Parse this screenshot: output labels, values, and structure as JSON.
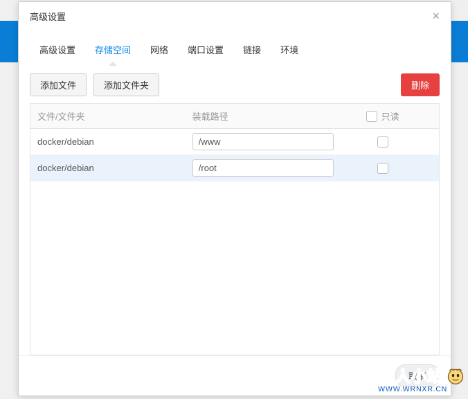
{
  "modal": {
    "title": "高级设置",
    "close": "×"
  },
  "tabs": {
    "items": [
      {
        "label": "高级设置"
      },
      {
        "label": "存储空间"
      },
      {
        "label": "网络"
      },
      {
        "label": "端口设置"
      },
      {
        "label": "链接"
      },
      {
        "label": "环境"
      }
    ]
  },
  "toolbar": {
    "add_file": "添加文件",
    "add_folder": "添加文件夹",
    "delete": "删除"
  },
  "table": {
    "headers": {
      "file": "文件/文件夹",
      "mount": "装载路径",
      "readonly": "只读"
    },
    "rows": [
      {
        "file": "docker/debian",
        "mount": "/www"
      },
      {
        "file": "docker/debian",
        "mount": "/root"
      }
    ]
  },
  "footer": {
    "cancel": "取消"
  },
  "watermark": {
    "text": "仙人小站",
    "url": "WWW.WRNXR.CN"
  }
}
